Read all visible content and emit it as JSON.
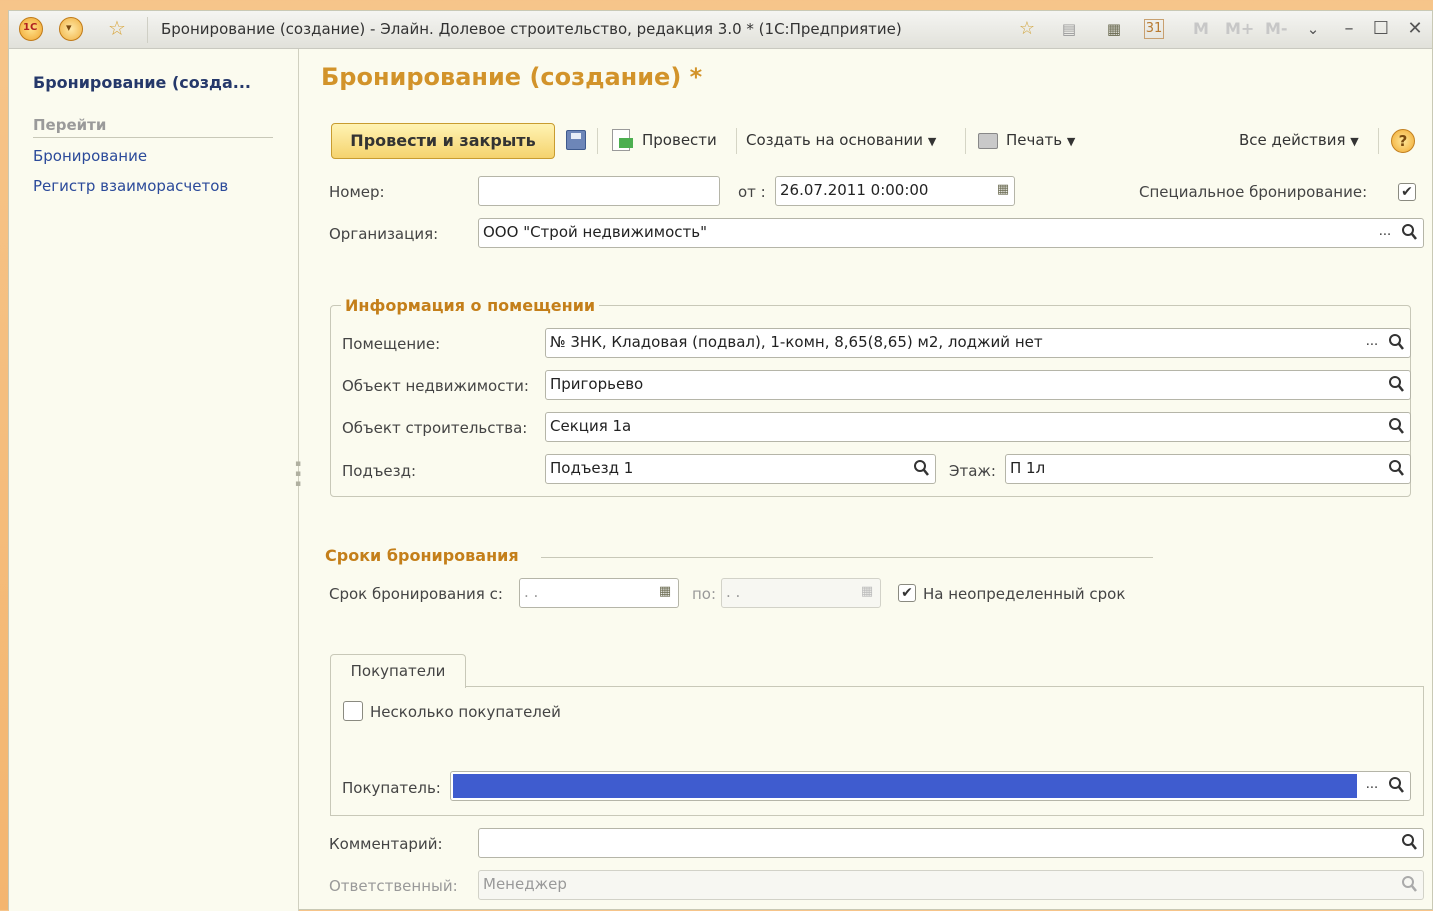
{
  "window": {
    "title": "Бронирование (создание) - Элайн. Долевое строительство, редакция 3.0 * (1С:Предприятие)",
    "logo_text": "1С",
    "m_buttons": [
      "M",
      "M+",
      "M-"
    ]
  },
  "sidebar": {
    "title": "Бронирование (созда...",
    "goto_label": "Перейти",
    "links": [
      "Бронирование",
      "Регистр взаиморасчетов"
    ]
  },
  "form": {
    "title": "Бронирование (создание) *",
    "toolbar": {
      "post_close": "Провести и закрыть",
      "post": "Провести",
      "create_based": "Создать на основании",
      "print": "Печать",
      "all_actions": "Все действия",
      "help": "?"
    },
    "number_label": "Номер:",
    "number_value": "",
    "date_label": "от :",
    "date_value": "26.07.2011  0:00:00",
    "special_label": "Специальное бронирование:",
    "special_checked": "✔",
    "org_label": "Организация:",
    "org_value": "ООО \"Строй недвижимость\"",
    "premises_group": {
      "title": "Информация о помещении",
      "room_label": "Помещение:",
      "room_value": "№ 3НК, Кладовая (подвал), 1-комн, 8,65(8,65)  м2, лоджий нет",
      "realty_label": "Объект недвижимости:",
      "realty_value": "Пригорьево",
      "construction_label": "Объект строительства:",
      "construction_value": "Секция 1а",
      "entrance_label": "Подъезд:",
      "entrance_value": "Подъезд 1",
      "floor_label": "Этаж:",
      "floor_value": "П  1л"
    },
    "booking_period": {
      "title": "Сроки бронирования",
      "from_label": "Срок бронирования с:",
      "from_value": " .  .",
      "to_label": "по:",
      "to_value": " .  .",
      "indefinite_label": "На неопределенный срок",
      "indefinite_checked": "✔"
    },
    "buyers_tab": {
      "tab_label": "Покупатели",
      "multiple_label": "Несколько покупателей",
      "buyer_label": "Покупатель:",
      "buyer_value": ""
    },
    "comment_label": "Комментарий:",
    "comment_value": "",
    "responsible_label": "Ответственный:",
    "responsible_value": "Менеджер"
  },
  "colors": {
    "title_accent": "#d2932a",
    "group_title": "#c47f1a",
    "link": "#2b4a9a",
    "buyer_selected": "#3f5ccf"
  }
}
